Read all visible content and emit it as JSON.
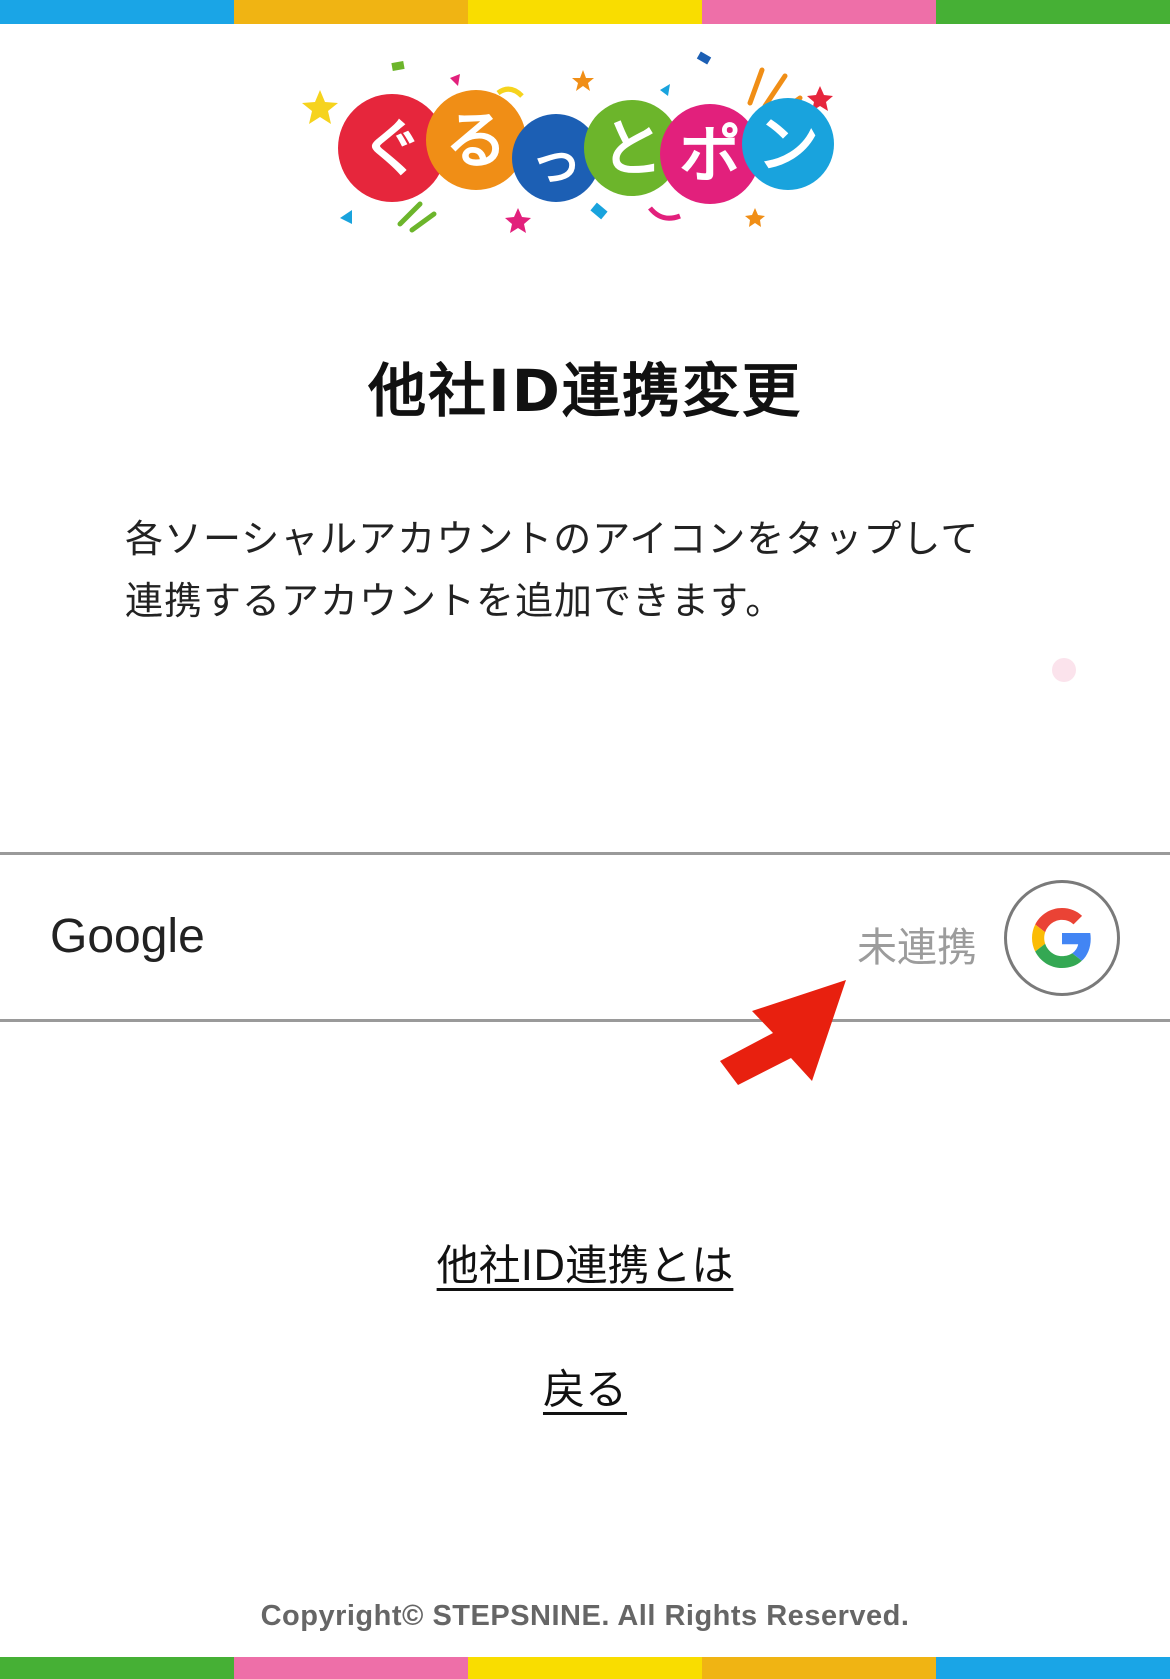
{
  "header": {
    "stripe_colors": [
      "#1aa5e6",
      "#f0b413",
      "#f9dd00",
      "#ee6fa8",
      "#46b035"
    ]
  },
  "logo": {
    "text": "ぐるっとポン",
    "chars": [
      "ぐ",
      "る",
      "っ",
      "と",
      "ポ",
      "ン"
    ],
    "colors": [
      "#e6263c",
      "#f08e16",
      "#1c5fb4",
      "#6cb52b",
      "#e2207c",
      "#19a3dd"
    ]
  },
  "page": {
    "title": "他社ID連携変更",
    "description_line1": "各ソーシャルアカウントのアイコンをタップして",
    "description_line2": "連携するアカウントを追加できます。"
  },
  "accounts": [
    {
      "provider": "Google",
      "status": "未連携",
      "icon": "google-icon"
    }
  ],
  "annotation": {
    "icon": "arrow-icon",
    "color": "#e8200f"
  },
  "links": {
    "about": "他社ID連携とは",
    "back": "戻る"
  },
  "footer": {
    "copyright": "Copyright© STEPSNINE. All Rights Reserved.",
    "stripe_colors": [
      "#46b035",
      "#ee6fa8",
      "#f9dd00",
      "#f0b413",
      "#1aa5e6"
    ]
  }
}
